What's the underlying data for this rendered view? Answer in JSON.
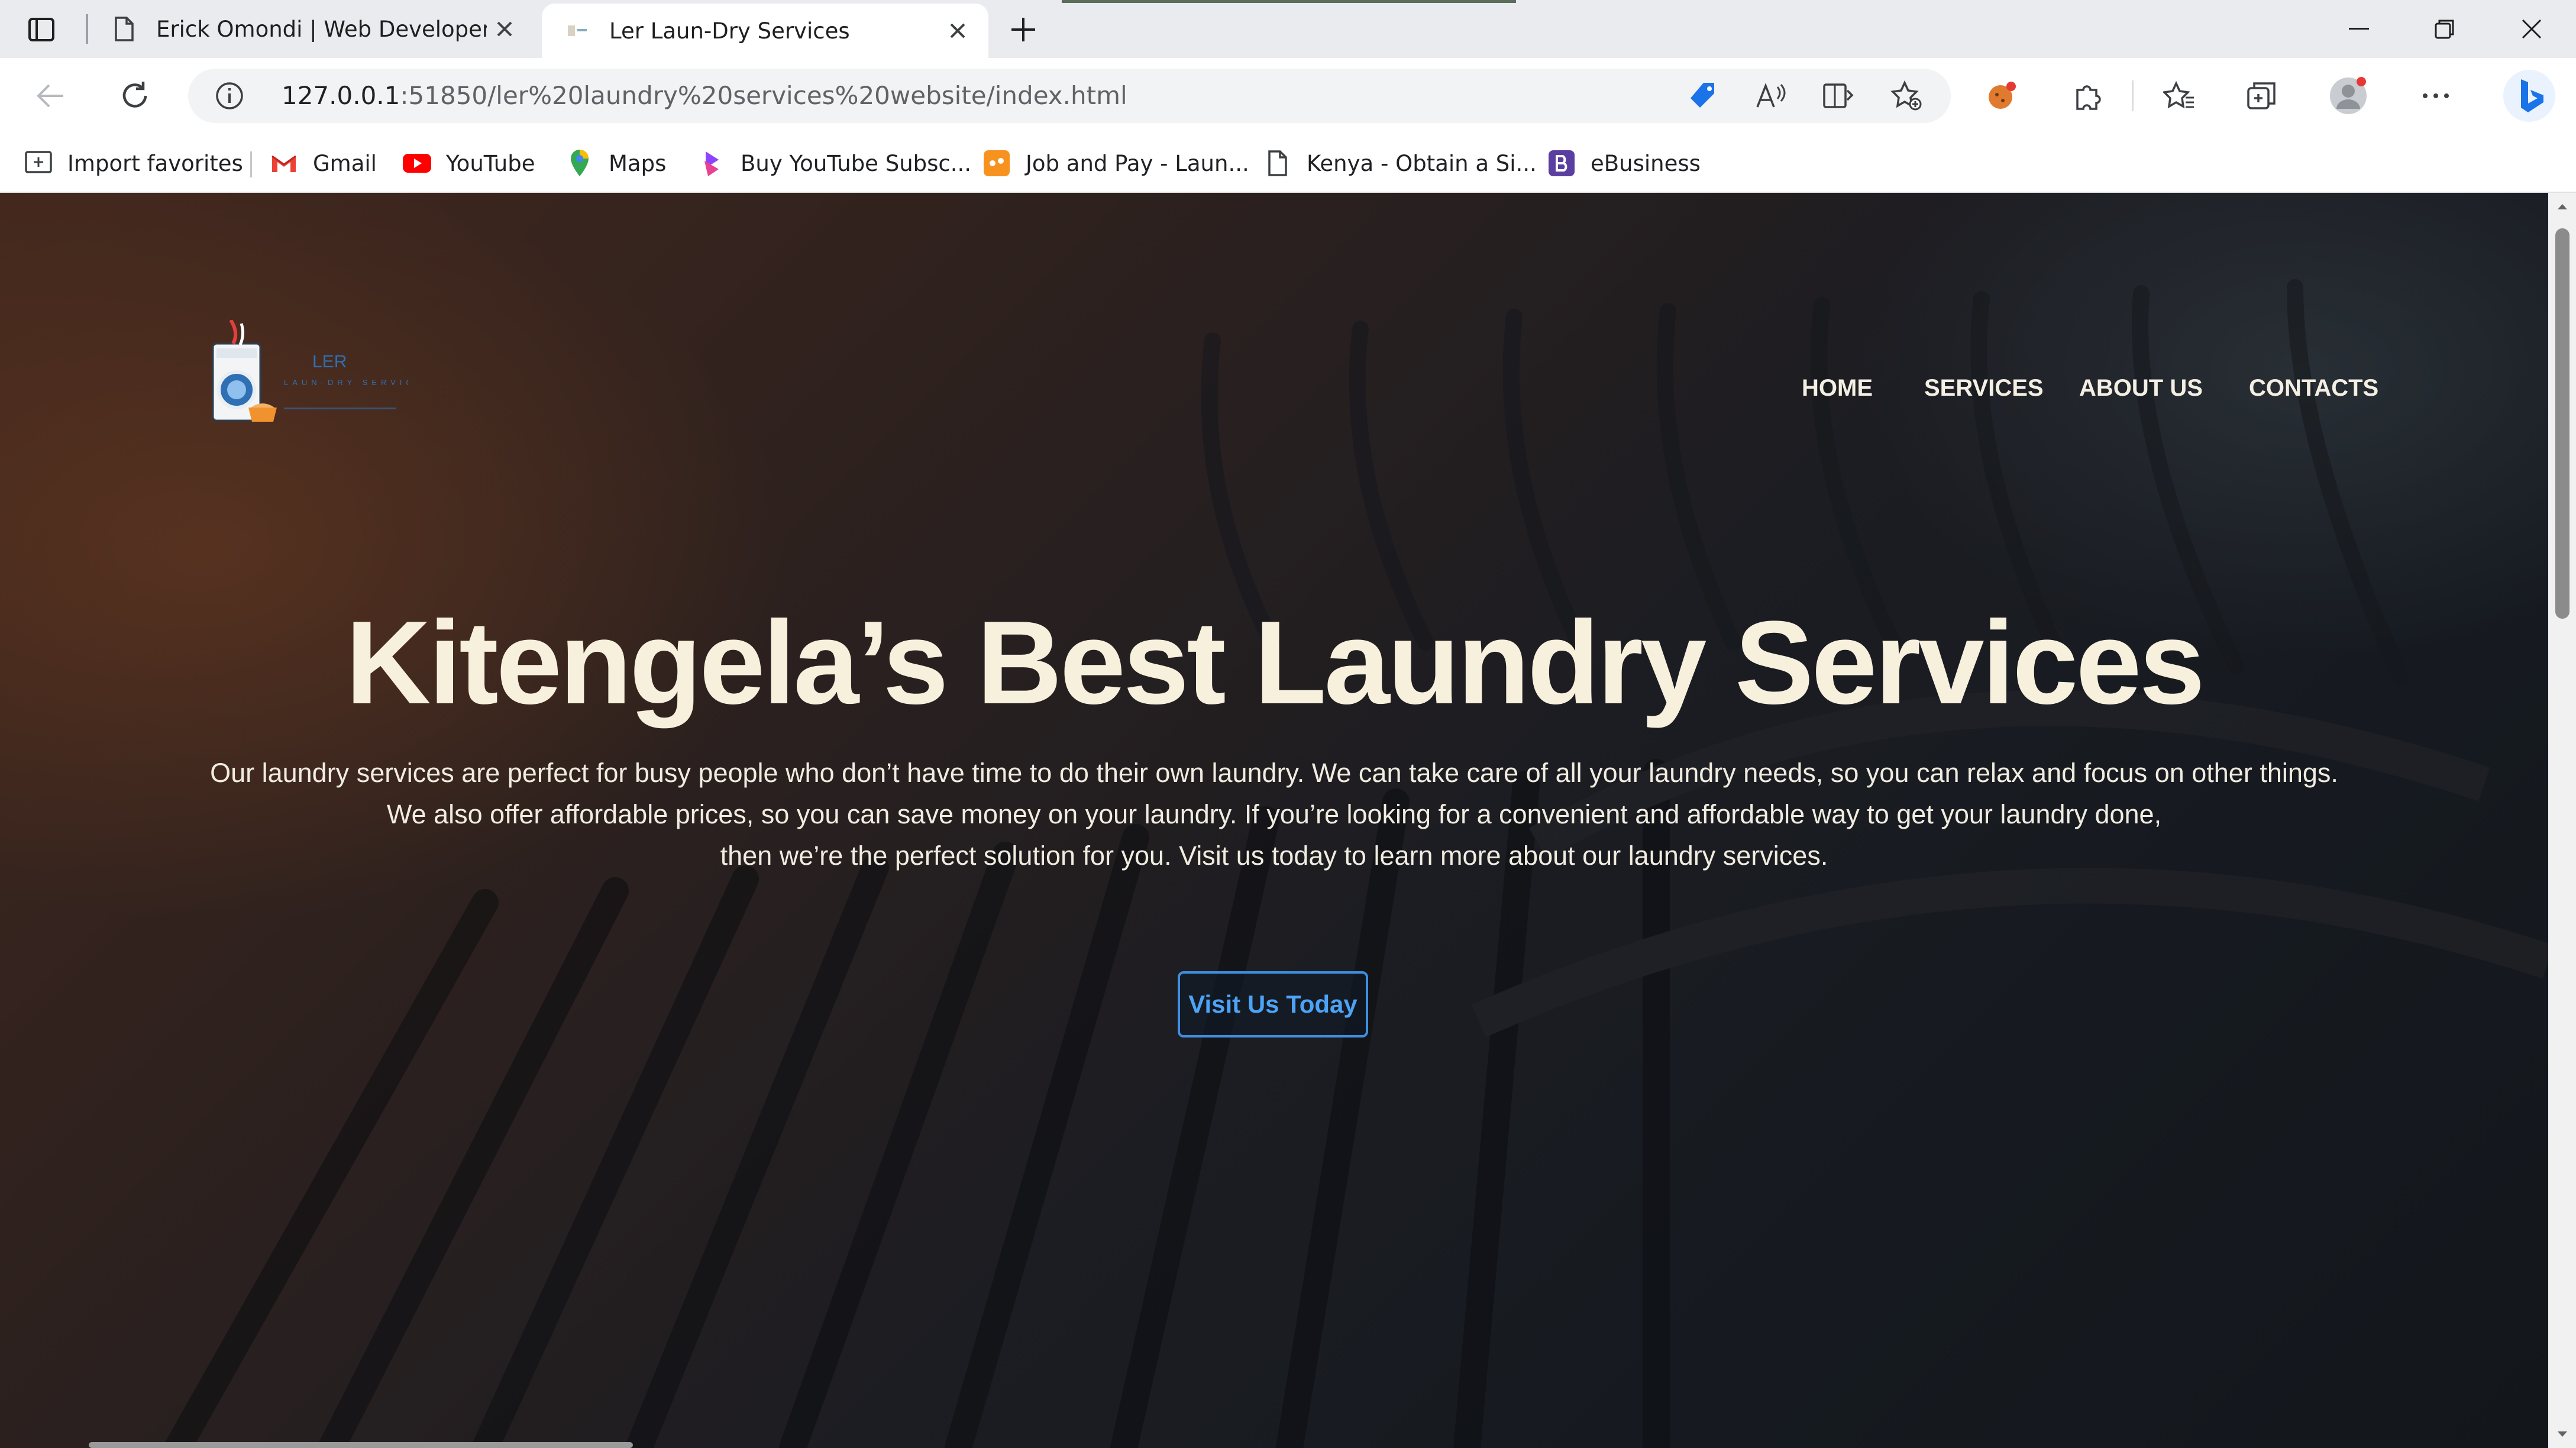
{
  "browser": {
    "tabs": [
      {
        "title": "Erick Omondi | Web Developer",
        "icon": "page-icon",
        "active": false
      },
      {
        "title": "Ler Laun-Dry Services",
        "icon": "site-favicon",
        "active": true
      }
    ],
    "url": {
      "host": "127.0.0.1",
      "rest": ":51850/ler%20laundry%20services%20website/index.html"
    },
    "bookmarks": [
      {
        "label": "Import favorites",
        "icon": "import-icon"
      },
      {
        "label": "Gmail",
        "icon": "gmail-icon"
      },
      {
        "label": "YouTube",
        "icon": "youtube-icon"
      },
      {
        "label": "Maps",
        "icon": "maps-icon"
      },
      {
        "label": "Buy YouTube Subsc...",
        "icon": "subscribe-icon"
      },
      {
        "label": "Job and Pay - Laun...",
        "icon": "job-icon"
      },
      {
        "label": "Kenya - Obtain a Si...",
        "icon": "page-icon"
      },
      {
        "label": "eBusiness",
        "icon": "ebusiness-icon"
      }
    ]
  },
  "site": {
    "logo": {
      "name": "LER",
      "tagline": "LAUN-DRY SERVICES"
    },
    "nav": [
      "HOME",
      "SERVICES",
      "ABOUT US",
      "CONTACTS"
    ],
    "hero": {
      "title": "Kitengela’s Best Laundry Services",
      "lines": [
        "Our laundry services are perfect for busy people who don’t have time to do their own laundry. We can take care of all your laundry needs, so you can relax and focus on other things.",
        "We also offer affordable prices, so you can save money on your laundry. If you’re looking for a convenient and affordable way to get your laundry done,",
        "then we’re the perfect solution for you. Visit us today to learn more about our laundry services."
      ],
      "cta": "Visit Us Today"
    }
  },
  "colors": {
    "hero_title": "#f6f0dd",
    "cta_accent": "#3e8fe0",
    "logo_accent": "#2f6fb3"
  }
}
